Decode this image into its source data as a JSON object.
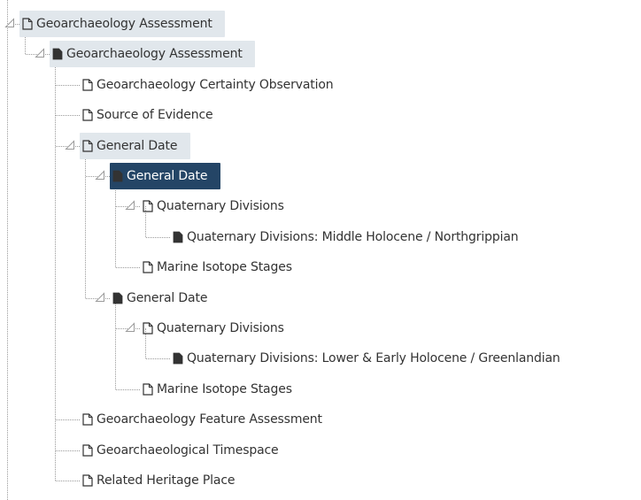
{
  "tree": {
    "nodes": [
      {
        "name": "tree-node-geoarchaeology-assessment-root",
        "label": "Geoarchaeology Assessment",
        "level": 0,
        "icon": "outline",
        "toggle": true,
        "state": "highlighted"
      },
      {
        "name": "tree-node-geoarchaeology-assessment",
        "label": "Geoarchaeology Assessment",
        "level": 1,
        "icon": "filled",
        "toggle": true,
        "state": "highlighted"
      },
      {
        "name": "tree-node-geoarchaeology-certainty-observation",
        "label": "Geoarchaeology Certainty Observation",
        "level": 2,
        "icon": "outline",
        "toggle": false,
        "state": "normal"
      },
      {
        "name": "tree-node-source-of-evidence",
        "label": "Source of Evidence",
        "level": 2,
        "icon": "outline",
        "toggle": false,
        "state": "normal"
      },
      {
        "name": "tree-node-general-date-group",
        "label": "General Date",
        "level": 2,
        "icon": "outline",
        "toggle": true,
        "state": "highlighted"
      },
      {
        "name": "tree-node-general-date-1",
        "label": "General Date",
        "level": 3,
        "icon": "filled",
        "toggle": true,
        "state": "selected"
      },
      {
        "name": "tree-node-quaternary-divisions-1",
        "label": "Quaternary Divisions",
        "level": 4,
        "icon": "outline",
        "toggle": true,
        "state": "normal"
      },
      {
        "name": "tree-node-quaternary-divisions-middle-holocene",
        "label": "Quaternary Divisions: Middle Holocene / Northgrippian",
        "level": 5,
        "icon": "filled",
        "toggle": false,
        "state": "normal"
      },
      {
        "name": "tree-node-marine-isotope-stages-1",
        "label": "Marine Isotope Stages",
        "level": 4,
        "icon": "outline",
        "toggle": false,
        "state": "normal"
      },
      {
        "name": "tree-node-general-date-2",
        "label": "General Date",
        "level": 3,
        "icon": "filled",
        "toggle": true,
        "state": "normal"
      },
      {
        "name": "tree-node-quaternary-divisions-2",
        "label": "Quaternary Divisions",
        "level": 4,
        "icon": "outline",
        "toggle": true,
        "state": "normal"
      },
      {
        "name": "tree-node-quaternary-divisions-lower-early-holocene",
        "label": "Quaternary Divisions: Lower & Early Holocene / Greenlandian",
        "level": 5,
        "icon": "filled",
        "toggle": false,
        "state": "normal"
      },
      {
        "name": "tree-node-marine-isotope-stages-2",
        "label": "Marine Isotope Stages",
        "level": 4,
        "icon": "outline",
        "toggle": false,
        "state": "normal"
      },
      {
        "name": "tree-node-geoarchaeology-feature-assessment",
        "label": "Geoarchaeology Feature Assessment",
        "level": 2,
        "icon": "outline",
        "toggle": false,
        "state": "normal"
      },
      {
        "name": "tree-node-geoarchaeological-timespace",
        "label": "Geoarchaeological Timespace",
        "level": 2,
        "icon": "outline",
        "toggle": false,
        "state": "normal"
      },
      {
        "name": "tree-node-related-heritage-place",
        "label": "Related Heritage Place",
        "level": 2,
        "icon": "outline",
        "toggle": false,
        "state": "normal"
      }
    ]
  },
  "colors": {
    "highlight_bg": "#e1e7ec",
    "selected_bg": "#244566",
    "selected_text": "#ffffff",
    "text": "#333333",
    "connector": "#9a9a9a"
  }
}
